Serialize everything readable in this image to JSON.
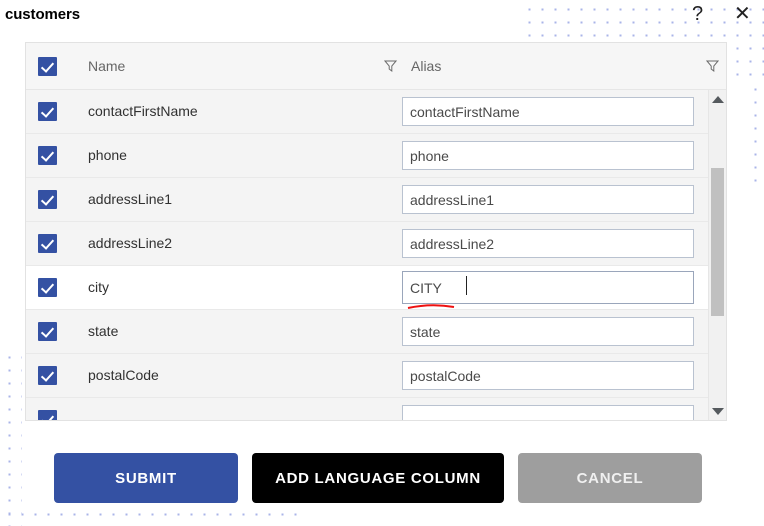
{
  "dialog": {
    "title": "customers",
    "help_icon": "question-mark-icon",
    "close_icon": "close-x-icon"
  },
  "table": {
    "header": {
      "select_all_checked": true,
      "columns": [
        {
          "label": "Name",
          "filter_icon": "filter-funnel-icon"
        },
        {
          "label": "Alias",
          "filter_icon": "filter-funnel-icon"
        }
      ]
    },
    "rows": [
      {
        "checked": true,
        "name": "contactFirstName",
        "alias": "contactFirstName",
        "focused": false
      },
      {
        "checked": true,
        "name": "phone",
        "alias": "phone",
        "focused": false
      },
      {
        "checked": true,
        "name": "addressLine1",
        "alias": "addressLine1",
        "focused": false
      },
      {
        "checked": true,
        "name": "addressLine2",
        "alias": "addressLine2",
        "focused": false
      },
      {
        "checked": true,
        "name": "city",
        "alias": "CITY",
        "focused": true
      },
      {
        "checked": true,
        "name": "state",
        "alias": "state",
        "focused": false
      },
      {
        "checked": true,
        "name": "postalCode",
        "alias": "postalCode",
        "focused": false
      },
      {
        "checked": true,
        "name": "",
        "alias": "",
        "focused": false
      }
    ]
  },
  "scrollbar": {
    "up_arrow_icon": "scroll-up-arrow-icon",
    "down_arrow_icon": "scroll-down-arrow-icon"
  },
  "buttons": {
    "submit": "SUBMIT",
    "add_language_column": "ADD LANGUAGE COLUMN",
    "cancel": "CANCEL"
  },
  "colors": {
    "accent_blue": "#3451a3",
    "black_button": "#000000",
    "cancel_gray": "#9e9e9e",
    "dot_pattern": "#aab4e8",
    "spellcheck_red": "#ee1111",
    "panel_bg": "#f4f4f4"
  }
}
